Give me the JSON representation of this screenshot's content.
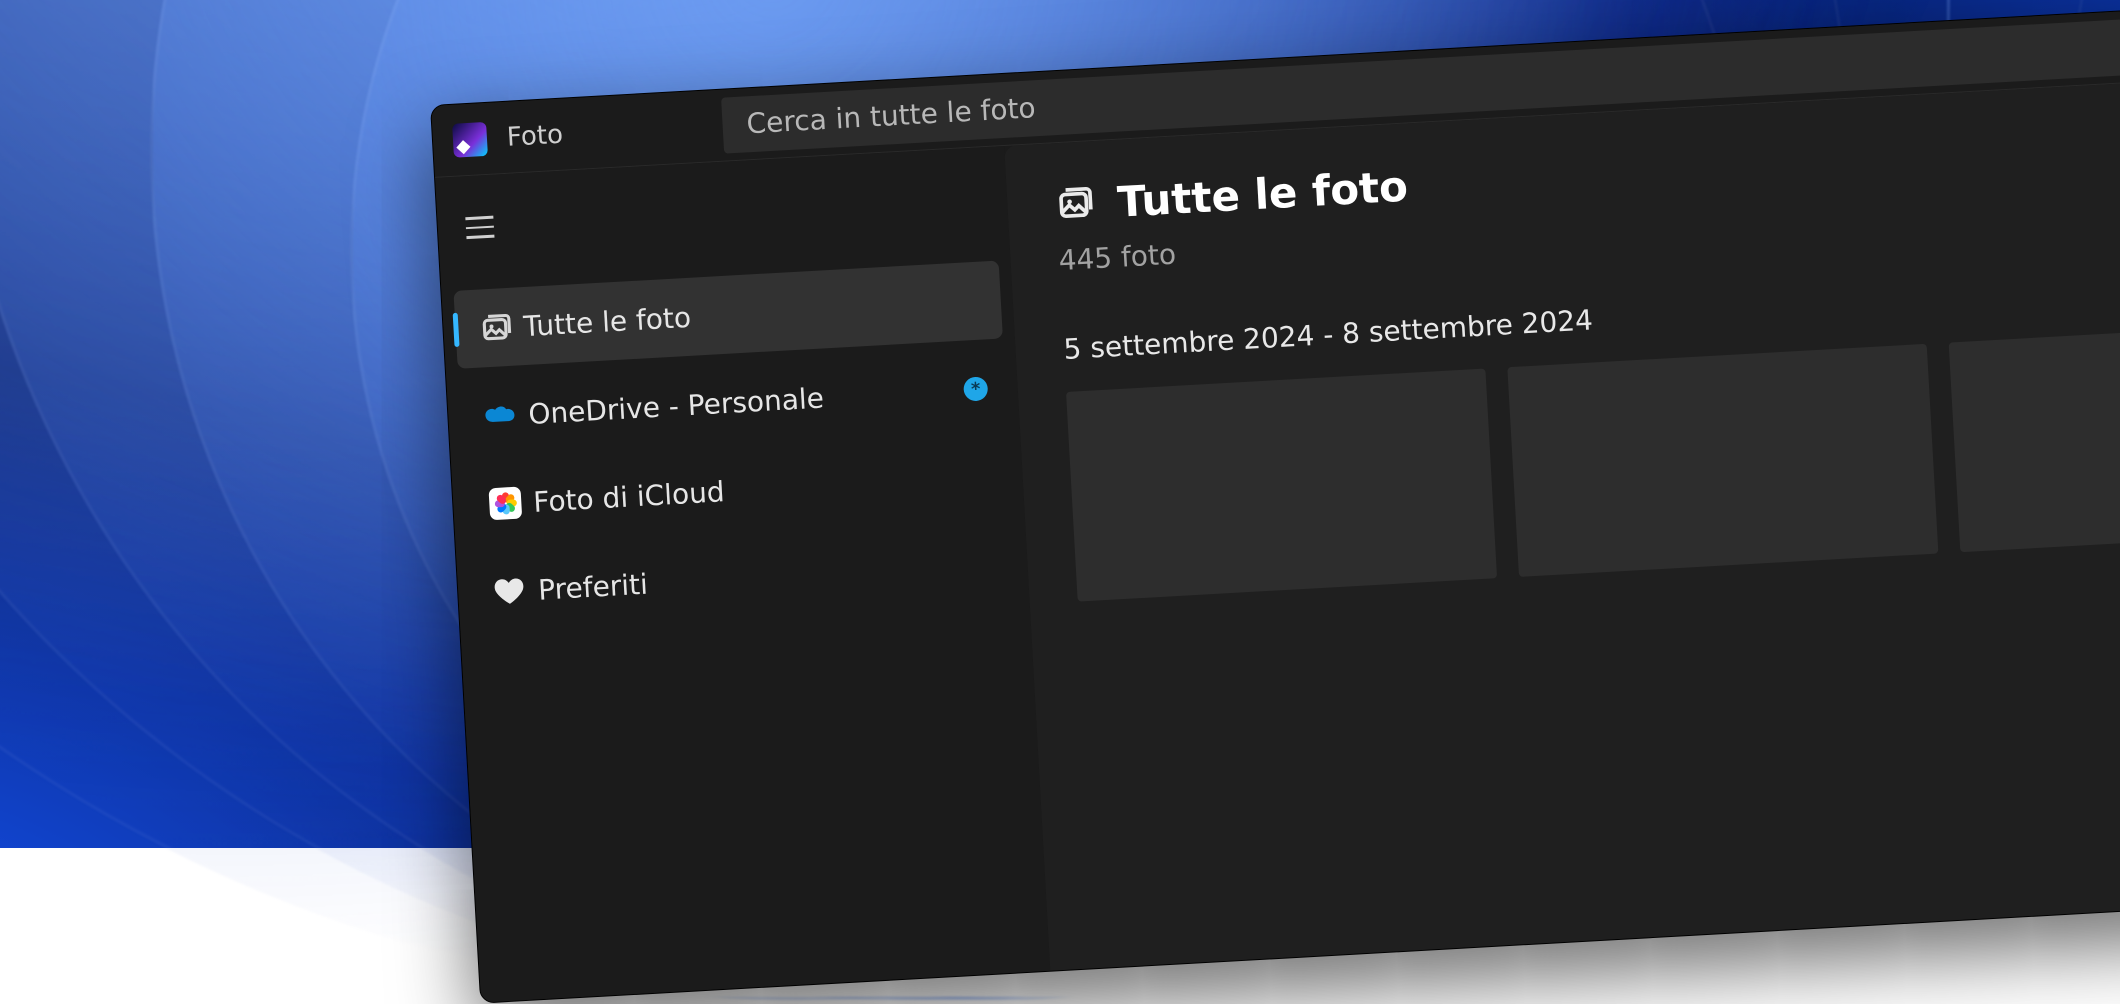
{
  "app": {
    "title": "Foto"
  },
  "search": {
    "placeholder": "Cerca in tutte le foto"
  },
  "sidebar": {
    "items": [
      {
        "label": "Tutte le foto"
      },
      {
        "label": "OneDrive - Personale"
      },
      {
        "label": "Foto di iCloud"
      },
      {
        "label": "Preferiti"
      }
    ],
    "badge": "*"
  },
  "main": {
    "title": "Tutte le foto",
    "count": "445 foto",
    "date_range": "5 settembre 2024 - 8 settembre 2024"
  }
}
